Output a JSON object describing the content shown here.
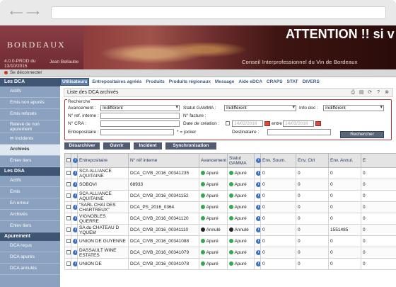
{
  "app": {
    "logo_text": "BORDEAUX",
    "version_line1": "4.0.0-PROD du",
    "version_line2": "13/10/2015",
    "user": "Jean Bellaube",
    "warning": "ATTENTION !! si v",
    "organization": "Conseil Interprofessionnel du Vin de Bordeaux",
    "disconnect": "Se déconnecter"
  },
  "menu": [
    "Utilisateurs",
    "Entrepositaires agréés",
    "Produits",
    "Produits régionaux",
    "Message",
    "Aide eDCA",
    "CRAPS",
    "STAT",
    "DIVERS"
  ],
  "sidebar": {
    "sections": [
      {
        "title": "Les DCA",
        "items": [
          "Actifs",
          "Emis non apurés",
          "Emis refusés",
          "Relevé de non apurement",
          "Incidents",
          "Archivés",
          "Enlev tiers"
        ]
      },
      {
        "title": "Les DSA",
        "items": [
          "Actifs",
          "Emis",
          "En erreur",
          "Archivés",
          "Enlev tiers"
        ]
      },
      {
        "title": "Apurement",
        "items": [
          "DCA reçus",
          "DCA apurés",
          "DCA annulés"
        ]
      }
    ],
    "active": "Archivés"
  },
  "panel": {
    "title": "Liste des DCA archivés"
  },
  "search": {
    "legend": "Recherche",
    "avancement_label": "Avancement :",
    "avancement_value": "Indifférent",
    "ref_interne_label": "N° ref. interne :",
    "cra_label": "N° CRA :",
    "entrepositaire_label": "Entrepositaire :",
    "jocker_note": "* = jocker",
    "statut_gamma_label": "Statut GAMMA :",
    "statut_gamma_value": "Indifférent",
    "facture_label": "N° facture :",
    "date_creation_label": "Date de création :",
    "date_from": "14/02/2016",
    "entre": "entre",
    "date_to": "14/03/2016",
    "destinataire_label": "Destinataire :",
    "info_doc_label": "Info doc :",
    "info_doc_value": "Indifférent",
    "search_button": "Rechercher"
  },
  "actions": [
    "Désarchiver",
    "Ouvrir",
    "Incident",
    "Synchronisation"
  ],
  "table": {
    "headers": [
      "Entrepositaire",
      "N° réf interne",
      "Avancement",
      "Statut GAMMA",
      "Env. Soum.",
      "Env. Ctrl",
      "Env. Annul.",
      "E"
    ],
    "rows": [
      {
        "entrepositaire": "SCA ALLIANCE AQUITAINE",
        "ref": "DCA_CIVB_2016_00341235",
        "avancement": "Apuré",
        "av_status": "green",
        "gamma": "Apuré",
        "gamma_status": "green",
        "soum": "0",
        "ctrl": "0",
        "annul": "0",
        "e": "0"
      },
      {
        "entrepositaire": "SOBOVI",
        "ref": "68933",
        "avancement": "Apuré",
        "av_status": "green",
        "gamma": "Apuré",
        "gamma_status": "green",
        "soum": "0",
        "ctrl": "0",
        "annul": "0",
        "e": "0"
      },
      {
        "entrepositaire": "SCA ALLIANCE AQUITAINE",
        "ref": "DCA_CIVB_2016_00341152",
        "avancement": "Apuré",
        "av_status": "green",
        "gamma": "Apuré",
        "gamma_status": "green",
        "soum": "0",
        "ctrl": "0",
        "annul": "0",
        "e": "0"
      },
      {
        "entrepositaire": "\"SARL CHAI DES CHARTREUX\"",
        "ref": "DCA_PS_2016_0364",
        "avancement": "Apuré",
        "av_status": "green",
        "gamma": "Apuré",
        "gamma_status": "green",
        "soum": "0",
        "ctrl": "0",
        "annul": "0",
        "e": "0"
      },
      {
        "entrepositaire": "VIGNOBLES QUERRE",
        "ref": "DCA_CIVB_2016_00341120",
        "avancement": "Apuré",
        "av_status": "green",
        "gamma": "Apuré",
        "gamma_status": "green",
        "soum": "0",
        "ctrl": "0",
        "annul": "0",
        "e": "0"
      },
      {
        "entrepositaire": "SA du CHATEAU D YQUEM",
        "ref": "DCA_CIVB_2016_00341110",
        "avancement": "Annulé",
        "av_status": "black",
        "gamma": "Annulé",
        "gamma_status": "black",
        "soum": "0",
        "ctrl": "0",
        "annul": "1551485",
        "e": "0"
      },
      {
        "entrepositaire": "UNION DE GUYENNE",
        "ref": "DCA_CIVB_2016_00341088",
        "avancement": "Apuré",
        "av_status": "green",
        "gamma": "Apuré",
        "gamma_status": "green",
        "soum": "0",
        "ctrl": "0",
        "annul": "0",
        "e": "0"
      },
      {
        "entrepositaire": "DASSAULT WINE ESTATES",
        "ref": "DCA_CIVB_2016_00341079",
        "avancement": "Apuré",
        "av_status": "green",
        "gamma": "Apuré",
        "gamma_status": "green",
        "soum": "0",
        "ctrl": "0",
        "annul": "0",
        "e": "0"
      },
      {
        "entrepositaire": "UNION DE",
        "ref": "DCA_CIVB_2016_00341078",
        "avancement": "Apuré",
        "av_status": "green",
        "gamma": "Apuré",
        "gamma_status": "green",
        "soum": "0",
        "ctrl": "0",
        "annul": "0",
        "e": "0"
      }
    ]
  },
  "colors": {
    "brand": "#6d2a2f",
    "sidebar": "#8aa2bf",
    "sidebar_head": "#3e5573",
    "status_ok": "#2fa84f",
    "status_cancel": "#222222",
    "search_border": "#b13a3a"
  }
}
